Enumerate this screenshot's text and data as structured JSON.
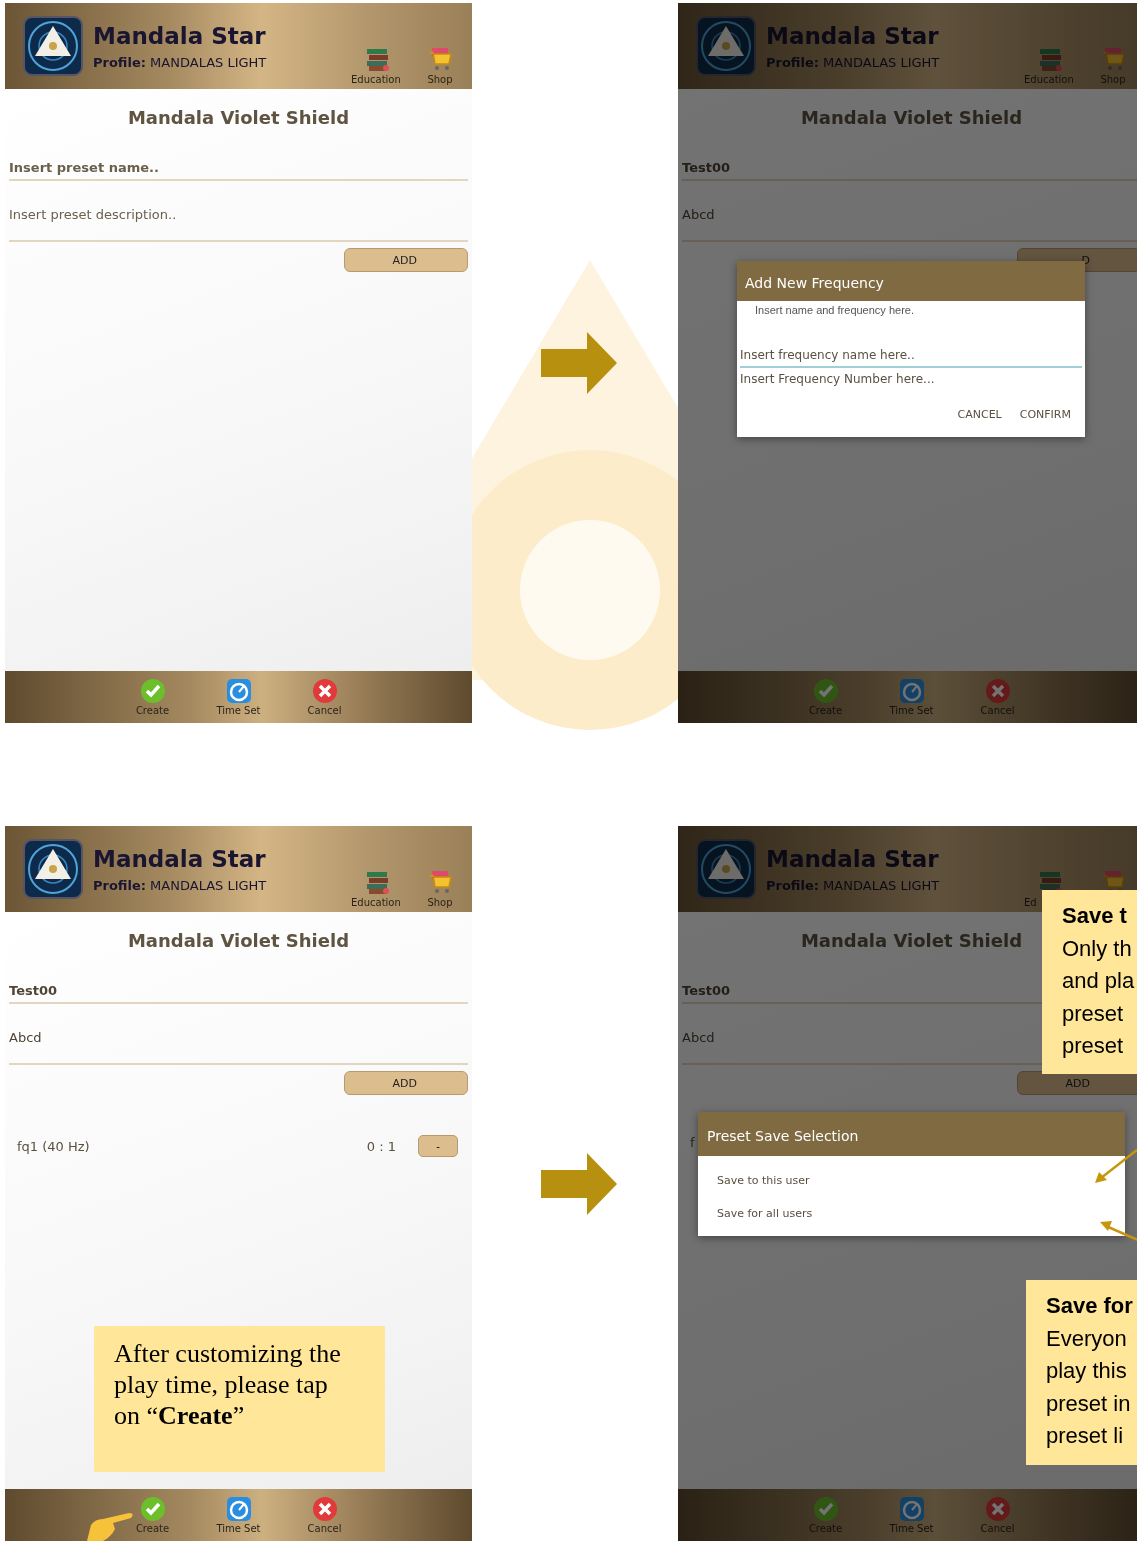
{
  "screens": [
    {
      "header": {
        "title": "Mandala Star",
        "profile": "**Profile:** MANDALAS LIGHT"
      },
      "toolbar": [
        {
          "kind": "books",
          "label": "Education"
        },
        {
          "kind": "cart",
          "label": "Shop"
        }
      ],
      "title": "Mandala Violet Shield",
      "name_field": {
        "placeholder": "Insert preset name.."
      },
      "description_field": {
        "placeholder": "Insert preset description.."
      },
      "add_button": "ADD",
      "bottom_bar": [
        {
          "kind": "check",
          "label": "Create"
        },
        {
          "kind": "timer",
          "label": "Time Set"
        },
        {
          "kind": "cancel",
          "label": "Cancel"
        }
      ],
      "dimmed": false
    },
    {
      "header": {
        "title": "Mandala Star",
        "profile": "**Profile:** MANDALAS LIGHT"
      },
      "toolbar": [
        {
          "kind": "books",
          "label": "Education"
        },
        {
          "kind": "cart",
          "label": "Shop"
        }
      ],
      "title": "Mandala Violet Shield",
      "name_field": {
        "value": "Test00"
      },
      "description_field": {
        "value": "Abcd"
      },
      "add_button": "D",
      "bottom_bar": [
        {
          "kind": "check",
          "label": "Create"
        },
        {
          "kind": "timer",
          "label": "Time Set"
        },
        {
          "kind": "cancel",
          "label": "Cancel"
        }
      ],
      "dimmed": true,
      "dialog": {
        "kind": "form",
        "title": "Add New Frequency",
        "message": "Insert name and frequency here.",
        "fields": [
          {
            "placeholder": "Insert frequency name here..",
            "focused": true
          },
          {
            "placeholder": "Insert Frequency Number here...",
            "focused": false
          }
        ],
        "buttons": [
          "CANCEL",
          "CONFIRM"
        ]
      }
    },
    {
      "header": {
        "title": "Mandala Star",
        "profile": "**Profile:** MANDALAS LIGHT"
      },
      "toolbar": [
        {
          "kind": "books",
          "label": "Education"
        },
        {
          "kind": "cart",
          "label": "Shop"
        }
      ],
      "title": "Mandala Violet Shield",
      "name_field": {
        "value": "Test00"
      },
      "description_field": {
        "value": "Abcd"
      },
      "add_button": "ADD",
      "frequencies": [
        {
          "name": "fq1 (40 Hz)",
          "ratio": "0 : 1",
          "button": "-"
        }
      ],
      "bottom_bar": [
        {
          "kind": "check",
          "label": "Create"
        },
        {
          "kind": "timer",
          "label": "Time Set"
        },
        {
          "kind": "cancel",
          "label": "Cancel"
        }
      ],
      "dimmed": false,
      "callouts": [
        {
          "kind": "create-hint",
          "text": "After customizing the play time, please tap on “**Create**”"
        }
      ]
    },
    {
      "header": {
        "title": "Mandala Star",
        "profile": "**Profile:** MANDALAS LIGHT"
      },
      "toolbar": [
        {
          "kind": "books",
          "label": "Ed"
        },
        {
          "kind": "cart"
        }
      ],
      "title": "Mandala Violet Shield",
      "name_field": {
        "value": "Test00"
      },
      "description_field": {
        "value": "Abcd"
      },
      "add_button": "ADD",
      "frequencies": [
        {
          "name": "f"
        }
      ],
      "bottom_bar": [
        {
          "kind": "check",
          "label": "Create"
        },
        {
          "kind": "timer",
          "label": "Time Set"
        },
        {
          "kind": "cancel",
          "label": "Cancel"
        }
      ],
      "dimmed": true,
      "dialog": {
        "kind": "list",
        "title": "Preset Save Selection",
        "options": [
          "Save to this user",
          "Save for all users"
        ]
      },
      "callouts": [
        {
          "kind": "this-user",
          "title": "Save t",
          "body": "Only th\nand pla\npreset\npreset"
        },
        {
          "kind": "all-users",
          "title": "Save for",
          "body": "Everyon\nplay this\npreset in\npreset li"
        }
      ]
    }
  ]
}
